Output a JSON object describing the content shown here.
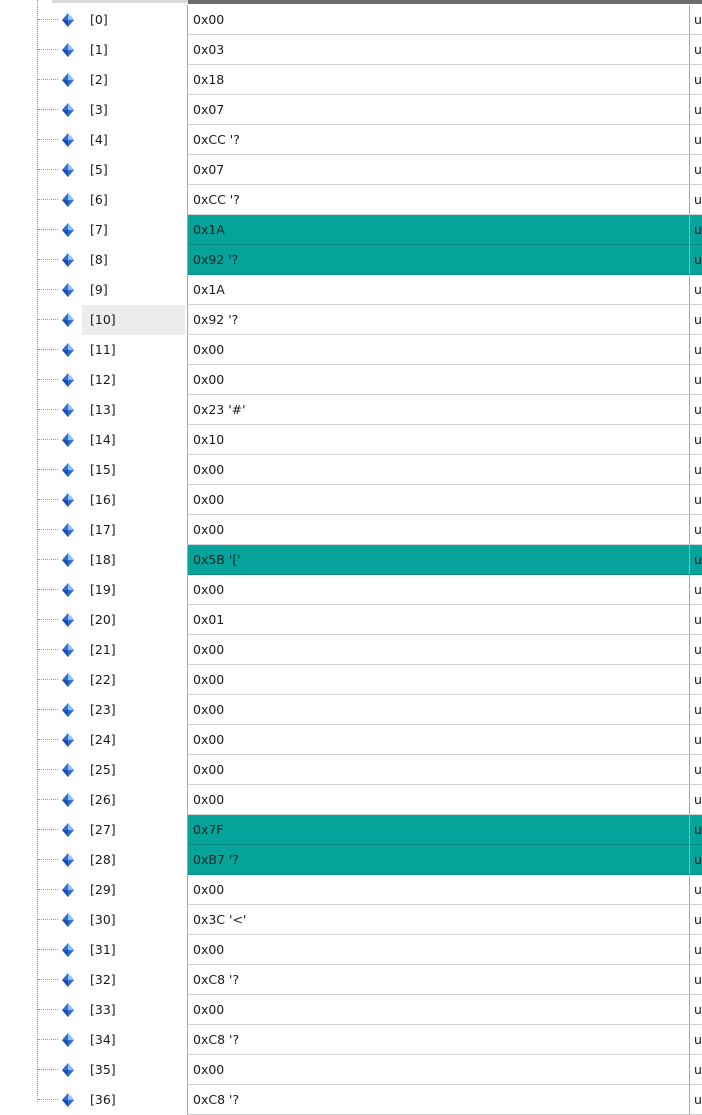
{
  "watch": {
    "rows": [
      {
        "name": "[0]",
        "value": "0x00",
        "type": "u",
        "changed": false,
        "selected": false
      },
      {
        "name": "[1]",
        "value": "0x03",
        "type": "u",
        "changed": false,
        "selected": false
      },
      {
        "name": "[2]",
        "value": "0x18",
        "type": "u",
        "changed": false,
        "selected": false
      },
      {
        "name": "[3]",
        "value": "0x07",
        "type": "u",
        "changed": false,
        "selected": false
      },
      {
        "name": "[4]",
        "value": "0xCC '?",
        "type": "u",
        "changed": false,
        "selected": false
      },
      {
        "name": "[5]",
        "value": "0x07",
        "type": "u",
        "changed": false,
        "selected": false
      },
      {
        "name": "[6]",
        "value": "0xCC '?",
        "type": "u",
        "changed": false,
        "selected": false
      },
      {
        "name": "[7]",
        "value": "0x1A",
        "type": "u",
        "changed": true,
        "selected": false
      },
      {
        "name": "[8]",
        "value": "0x92 '?",
        "type": "u",
        "changed": true,
        "selected": false
      },
      {
        "name": "[9]",
        "value": "0x1A",
        "type": "u",
        "changed": false,
        "selected": false
      },
      {
        "name": "[10]",
        "value": "0x92 '?",
        "type": "u",
        "changed": false,
        "selected": true
      },
      {
        "name": "[11]",
        "value": "0x00",
        "type": "u",
        "changed": false,
        "selected": false
      },
      {
        "name": "[12]",
        "value": "0x00",
        "type": "u",
        "changed": false,
        "selected": false
      },
      {
        "name": "[13]",
        "value": "0x23 '#'",
        "type": "u",
        "changed": false,
        "selected": false
      },
      {
        "name": "[14]",
        "value": "0x10",
        "type": "u",
        "changed": false,
        "selected": false
      },
      {
        "name": "[15]",
        "value": "0x00",
        "type": "u",
        "changed": false,
        "selected": false
      },
      {
        "name": "[16]",
        "value": "0x00",
        "type": "u",
        "changed": false,
        "selected": false
      },
      {
        "name": "[17]",
        "value": "0x00",
        "type": "u",
        "changed": false,
        "selected": false
      },
      {
        "name": "[18]",
        "value": "0x5B '['",
        "type": "u",
        "changed": true,
        "selected": false
      },
      {
        "name": "[19]",
        "value": "0x00",
        "type": "u",
        "changed": false,
        "selected": false
      },
      {
        "name": "[20]",
        "value": "0x01",
        "type": "u",
        "changed": false,
        "selected": false
      },
      {
        "name": "[21]",
        "value": "0x00",
        "type": "u",
        "changed": false,
        "selected": false
      },
      {
        "name": "[22]",
        "value": "0x00",
        "type": "u",
        "changed": false,
        "selected": false
      },
      {
        "name": "[23]",
        "value": "0x00",
        "type": "u",
        "changed": false,
        "selected": false
      },
      {
        "name": "[24]",
        "value": "0x00",
        "type": "u",
        "changed": false,
        "selected": false
      },
      {
        "name": "[25]",
        "value": "0x00",
        "type": "u",
        "changed": false,
        "selected": false
      },
      {
        "name": "[26]",
        "value": "0x00",
        "type": "u",
        "changed": false,
        "selected": false
      },
      {
        "name": "[27]",
        "value": "0x7F",
        "type": "u",
        "changed": true,
        "selected": false
      },
      {
        "name": "[28]",
        "value": "0xB7 '?",
        "type": "u",
        "changed": true,
        "selected": false
      },
      {
        "name": "[29]",
        "value": "0x00",
        "type": "u",
        "changed": false,
        "selected": false
      },
      {
        "name": "[30]",
        "value": "0x3C '<'",
        "type": "u",
        "changed": false,
        "selected": false
      },
      {
        "name": "[31]",
        "value": "0x00",
        "type": "u",
        "changed": false,
        "selected": false
      },
      {
        "name": "[32]",
        "value": "0xC8 '?",
        "type": "u",
        "changed": false,
        "selected": false
      },
      {
        "name": "[33]",
        "value": "0x00",
        "type": "u",
        "changed": false,
        "selected": false
      },
      {
        "name": "[34]",
        "value": "0xC8 '?",
        "type": "u",
        "changed": false,
        "selected": false
      },
      {
        "name": "[35]",
        "value": "0x00",
        "type": "u",
        "changed": false,
        "selected": false
      },
      {
        "name": "[36]",
        "value": "0xC8 '?",
        "type": "u",
        "changed": false,
        "selected": false
      }
    ]
  },
  "colors": {
    "changed_value_bg": "#06a39a",
    "selected_name_bg": "#ececec",
    "icon_primary": "#2f6fd6"
  },
  "icons": {
    "element": "variable-diamond-icon"
  }
}
